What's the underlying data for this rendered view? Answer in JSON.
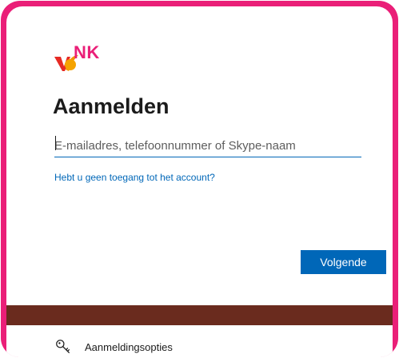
{
  "brand": {
    "logo_text": "NK",
    "accent_color": "#ea1f78",
    "logo_orange": "#f39200",
    "logo_red": "#e62a24"
  },
  "signin": {
    "title": "Aanmelden",
    "email_placeholder": "E-mailadres, telefoonnummer of Skype-naam",
    "email_value": "",
    "help_link": "Hebt u geen toegang tot het account?",
    "next_label": "Volgende"
  },
  "footer": {
    "options_label": "Aanmeldingsopties",
    "options_icon": "key-icon",
    "band_color": "#6a2b1e"
  },
  "colors": {
    "primary": "#0067b8",
    "frame": "#ea1f78",
    "text": "#1b1b1b"
  }
}
